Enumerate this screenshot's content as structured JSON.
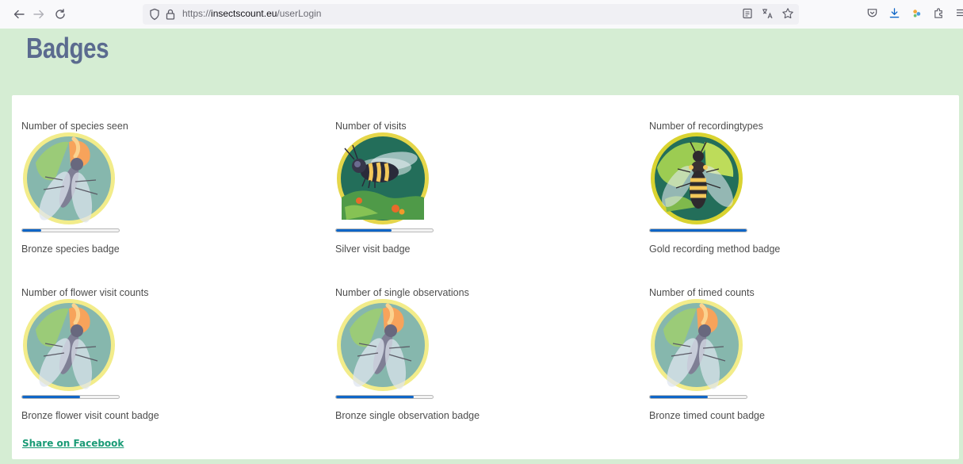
{
  "browser": {
    "url_host": "insectscount.eu",
    "url_prefix": "https://",
    "url_path": "/userLogin"
  },
  "page": {
    "title": "Badges",
    "share_label": "Share on Facebook"
  },
  "badges": [
    {
      "title": "Number of species seen",
      "name": "Bronze species badge",
      "progress": 0.2,
      "image": "fly-on-leaf-icon"
    },
    {
      "title": "Number of visits",
      "name": "Silver visit badge",
      "progress": 0.57,
      "image": "hoverfly-flying-icon"
    },
    {
      "title": "Number of recordingtypes",
      "name": "Gold recording method badge",
      "progress": 1.0,
      "image": "wasp-on-leaf-icon"
    },
    {
      "title": "Number of flower visit counts",
      "name": "Bronze flower visit count badge",
      "progress": 0.6,
      "image": "fly-on-leaf-icon"
    },
    {
      "title": "Number of single observations",
      "name": "Bronze single observation badge",
      "progress": 0.8,
      "image": "fly-on-leaf-icon"
    },
    {
      "title": "Number of timed counts",
      "name": "Bronze timed count badge",
      "progress": 0.6,
      "image": "fly-on-leaf-icon"
    }
  ],
  "colors": {
    "header_bg": "#d5edd3",
    "progress_fill": "#0f66c7",
    "share_link": "#1a9b76",
    "title": "#5b6b8f"
  }
}
